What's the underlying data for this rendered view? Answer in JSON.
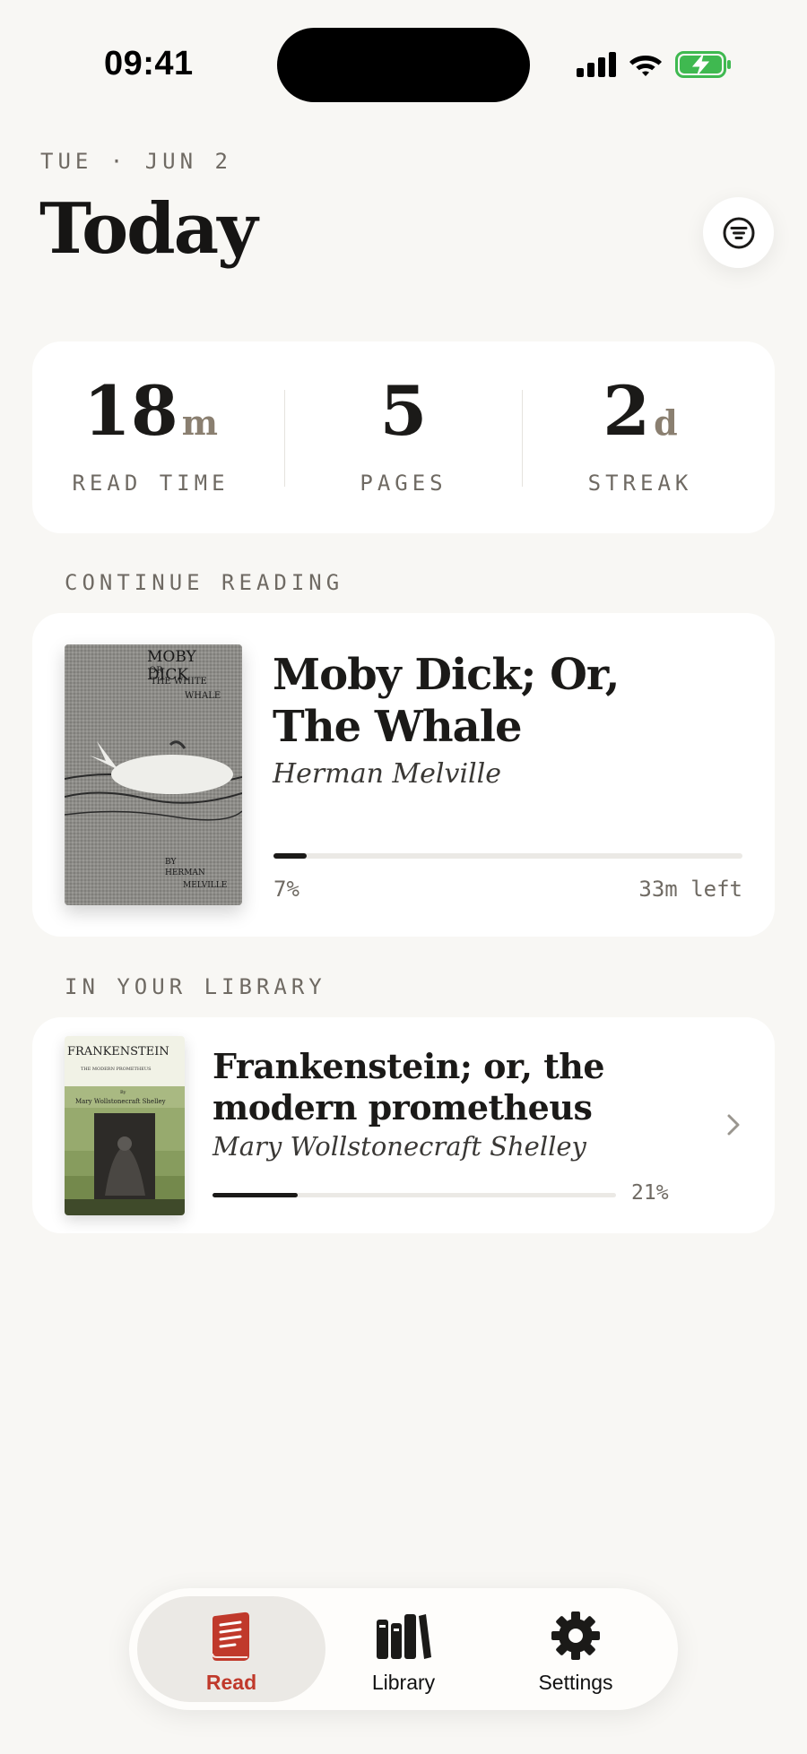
{
  "status_bar": {
    "time": "09:41"
  },
  "header": {
    "date": "TUE · JUN 2",
    "title": "Today",
    "filter_icon": "filter-lines-icon"
  },
  "stats": [
    {
      "value": "18",
      "unit": "m",
      "label": "READ TIME"
    },
    {
      "value": "5",
      "unit": "",
      "label": "PAGES"
    },
    {
      "value": "2",
      "unit": "d",
      "label": "STREAK"
    }
  ],
  "continue_reading": {
    "section_label": "CONTINUE READING",
    "book": {
      "title": "Moby Dick; Or, The Whale",
      "author": "Herman Melville",
      "progress_label": "7%",
      "progress": 0.07,
      "time_left": "33m left",
      "cover": {
        "title": "MOBY DICK",
        "subtitle_1": "OR",
        "subtitle_2": "THE WHITE",
        "subtitle_3": "WHALE",
        "by": "BY",
        "author_1": "HERMAN",
        "author_2": "MELVILLE"
      }
    }
  },
  "library": {
    "section_label": "IN YOUR LIBRARY",
    "books": [
      {
        "title": "Frankenstein; or, the modern prometheus",
        "author": "Mary Wollstonecraft Shelley",
        "progress_label": "21%",
        "progress": 0.21,
        "cover": {
          "title": "FRANKENSTEIN",
          "subtitle": "THE MODERN PROMETHEUS",
          "by": "By",
          "author": "Mary Wollstonecraft Shelley"
        }
      }
    ]
  },
  "tabbar": {
    "tabs": [
      {
        "label": "Read",
        "icon": "book-icon",
        "active": true
      },
      {
        "label": "Library",
        "icon": "bookshelf-icon",
        "active": false
      },
      {
        "label": "Settings",
        "icon": "gear-icon",
        "active": false
      }
    ]
  },
  "colors": {
    "background": "#f8f7f4",
    "card": "#ffffff",
    "accent_red": "#c0392b",
    "text_primary": "#1b1a18",
    "text_muted": "#6f6a63"
  }
}
